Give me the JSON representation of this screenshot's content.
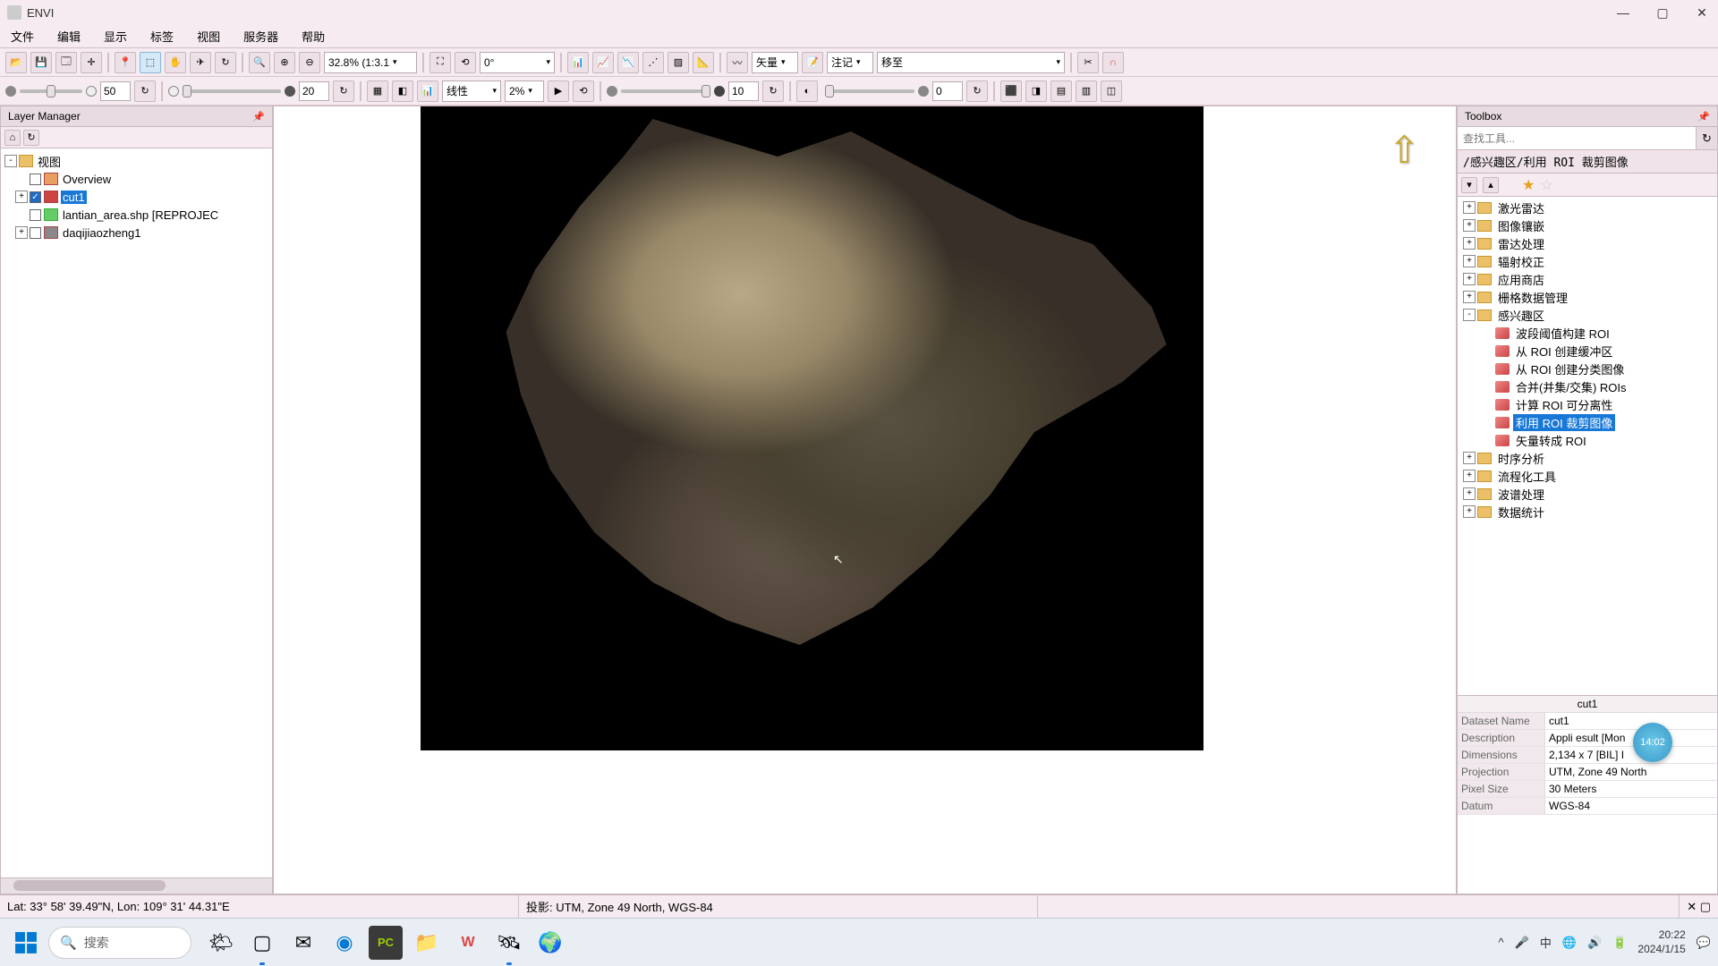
{
  "app": {
    "title": "ENVI"
  },
  "menu": [
    "文件",
    "编辑",
    "显示",
    "标签",
    "视图",
    "服务器",
    "帮助"
  ],
  "toolbar1": {
    "zoom": "32.8% (1:3.1",
    "rotation": "0°",
    "vector": "矢量",
    "annotation": "注记",
    "goto_label": "移至"
  },
  "toolbar2": {
    "val1": "50",
    "stretch_label": "线性",
    "stretch_pct": "2%",
    "val2": "20",
    "val3": "10",
    "val4": "0"
  },
  "layer_panel": {
    "title": "Layer Manager",
    "root": "视图",
    "items": [
      {
        "label": "Overview",
        "checked": false
      },
      {
        "label": "cut1",
        "checked": true,
        "selected": true
      },
      {
        "label": "lantian_area.shp [REPROJEC",
        "checked": false
      },
      {
        "label": "daqijiaozheng1",
        "checked": false
      }
    ]
  },
  "toolbox": {
    "title": "Toolbox",
    "search_placeholder": "查找工具...",
    "breadcrumb": "/感兴趣区/利用 ROI 裁剪图像",
    "folders": [
      "激光雷达",
      "图像镶嵌",
      "雷达处理",
      "辐射校正",
      "应用商店",
      "栅格数据管理"
    ],
    "open_folder": "感兴趣区",
    "tools": [
      "波段阈值构建 ROI",
      "从 ROI 创建缓冲区",
      "从 ROI 创建分类图像",
      "合并(并集/交集) ROIs",
      "计算 ROI 可分离性",
      "利用 ROI 裁剪图像",
      "矢量转成 ROI"
    ],
    "selected_tool": "利用 ROI 裁剪图像",
    "folders_after": [
      "时序分析",
      "流程化工具",
      "波谱处理",
      "数据统计"
    ]
  },
  "info": {
    "title": "cut1",
    "rows": [
      {
        "k": "Dataset Name",
        "v": "cut1"
      },
      {
        "k": "Description",
        "v": "Appli       esult [Mon"
      },
      {
        "k": "Dimensions",
        "v": "2,134         x 7 [BIL] I"
      },
      {
        "k": "Projection",
        "v": "UTM, Zone 49 North"
      },
      {
        "k": "Pixel Size",
        "v": "30 Meters"
      },
      {
        "k": "Datum",
        "v": "WGS-84"
      }
    ],
    "badge": "14:02"
  },
  "status": {
    "coords": "Lat: 33° 58' 39.49\"N, Lon: 109° 31' 44.31\"E",
    "projection": "投影:  UTM, Zone 49 North, WGS-84"
  },
  "taskbar": {
    "search": "搜索",
    "time": "20:22",
    "date": "2024/1/15"
  }
}
